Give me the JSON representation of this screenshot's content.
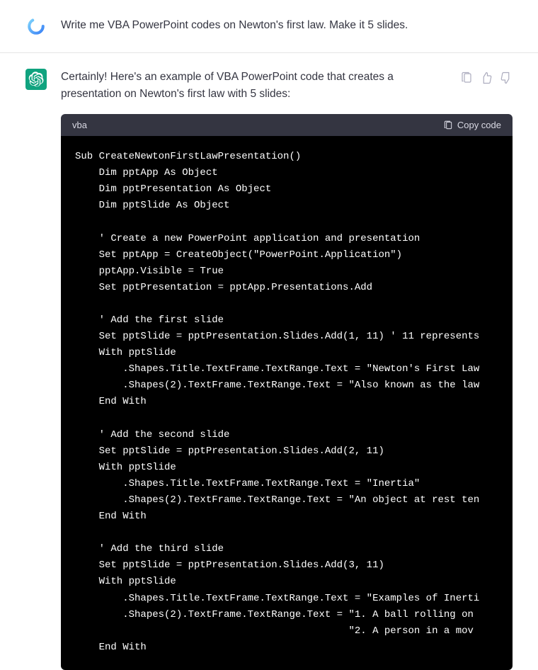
{
  "user_message": {
    "text": "Write me VBA PowerPoint codes on Newton's first law. Make it 5 slides."
  },
  "assistant_message": {
    "intro": "Certainly! Here's an example of VBA PowerPoint code that creates a presentation on Newton's first law with 5 slides:"
  },
  "code_block": {
    "language": "vba",
    "copy_label": "Copy code",
    "code": "Sub CreateNewtonFirstLawPresentation()\n    Dim pptApp As Object\n    Dim pptPresentation As Object\n    Dim pptSlide As Object\n\n    ' Create a new PowerPoint application and presentation\n    Set pptApp = CreateObject(\"PowerPoint.Application\")\n    pptApp.Visible = True\n    Set pptPresentation = pptApp.Presentations.Add\n\n    ' Add the first slide\n    Set pptSlide = pptPresentation.Slides.Add(1, 11) ' 11 represents\n    With pptSlide\n        .Shapes.Title.TextFrame.TextRange.Text = \"Newton's First Law\n        .Shapes(2).TextFrame.TextRange.Text = \"Also known as the law\n    End With\n\n    ' Add the second slide\n    Set pptSlide = pptPresentation.Slides.Add(2, 11)\n    With pptSlide\n        .Shapes.Title.TextFrame.TextRange.Text = \"Inertia\"\n        .Shapes(2).TextFrame.TextRange.Text = \"An object at rest ten\n    End With\n\n    ' Add the third slide\n    Set pptSlide = pptPresentation.Slides.Add(3, 11)\n    With pptSlide\n        .Shapes.Title.TextFrame.TextRange.Text = \"Examples of Inerti\n        .Shapes(2).TextFrame.TextRange.Text = \"1. A ball rolling on \n                                              \"2. A person in a mov\n    End With"
  }
}
